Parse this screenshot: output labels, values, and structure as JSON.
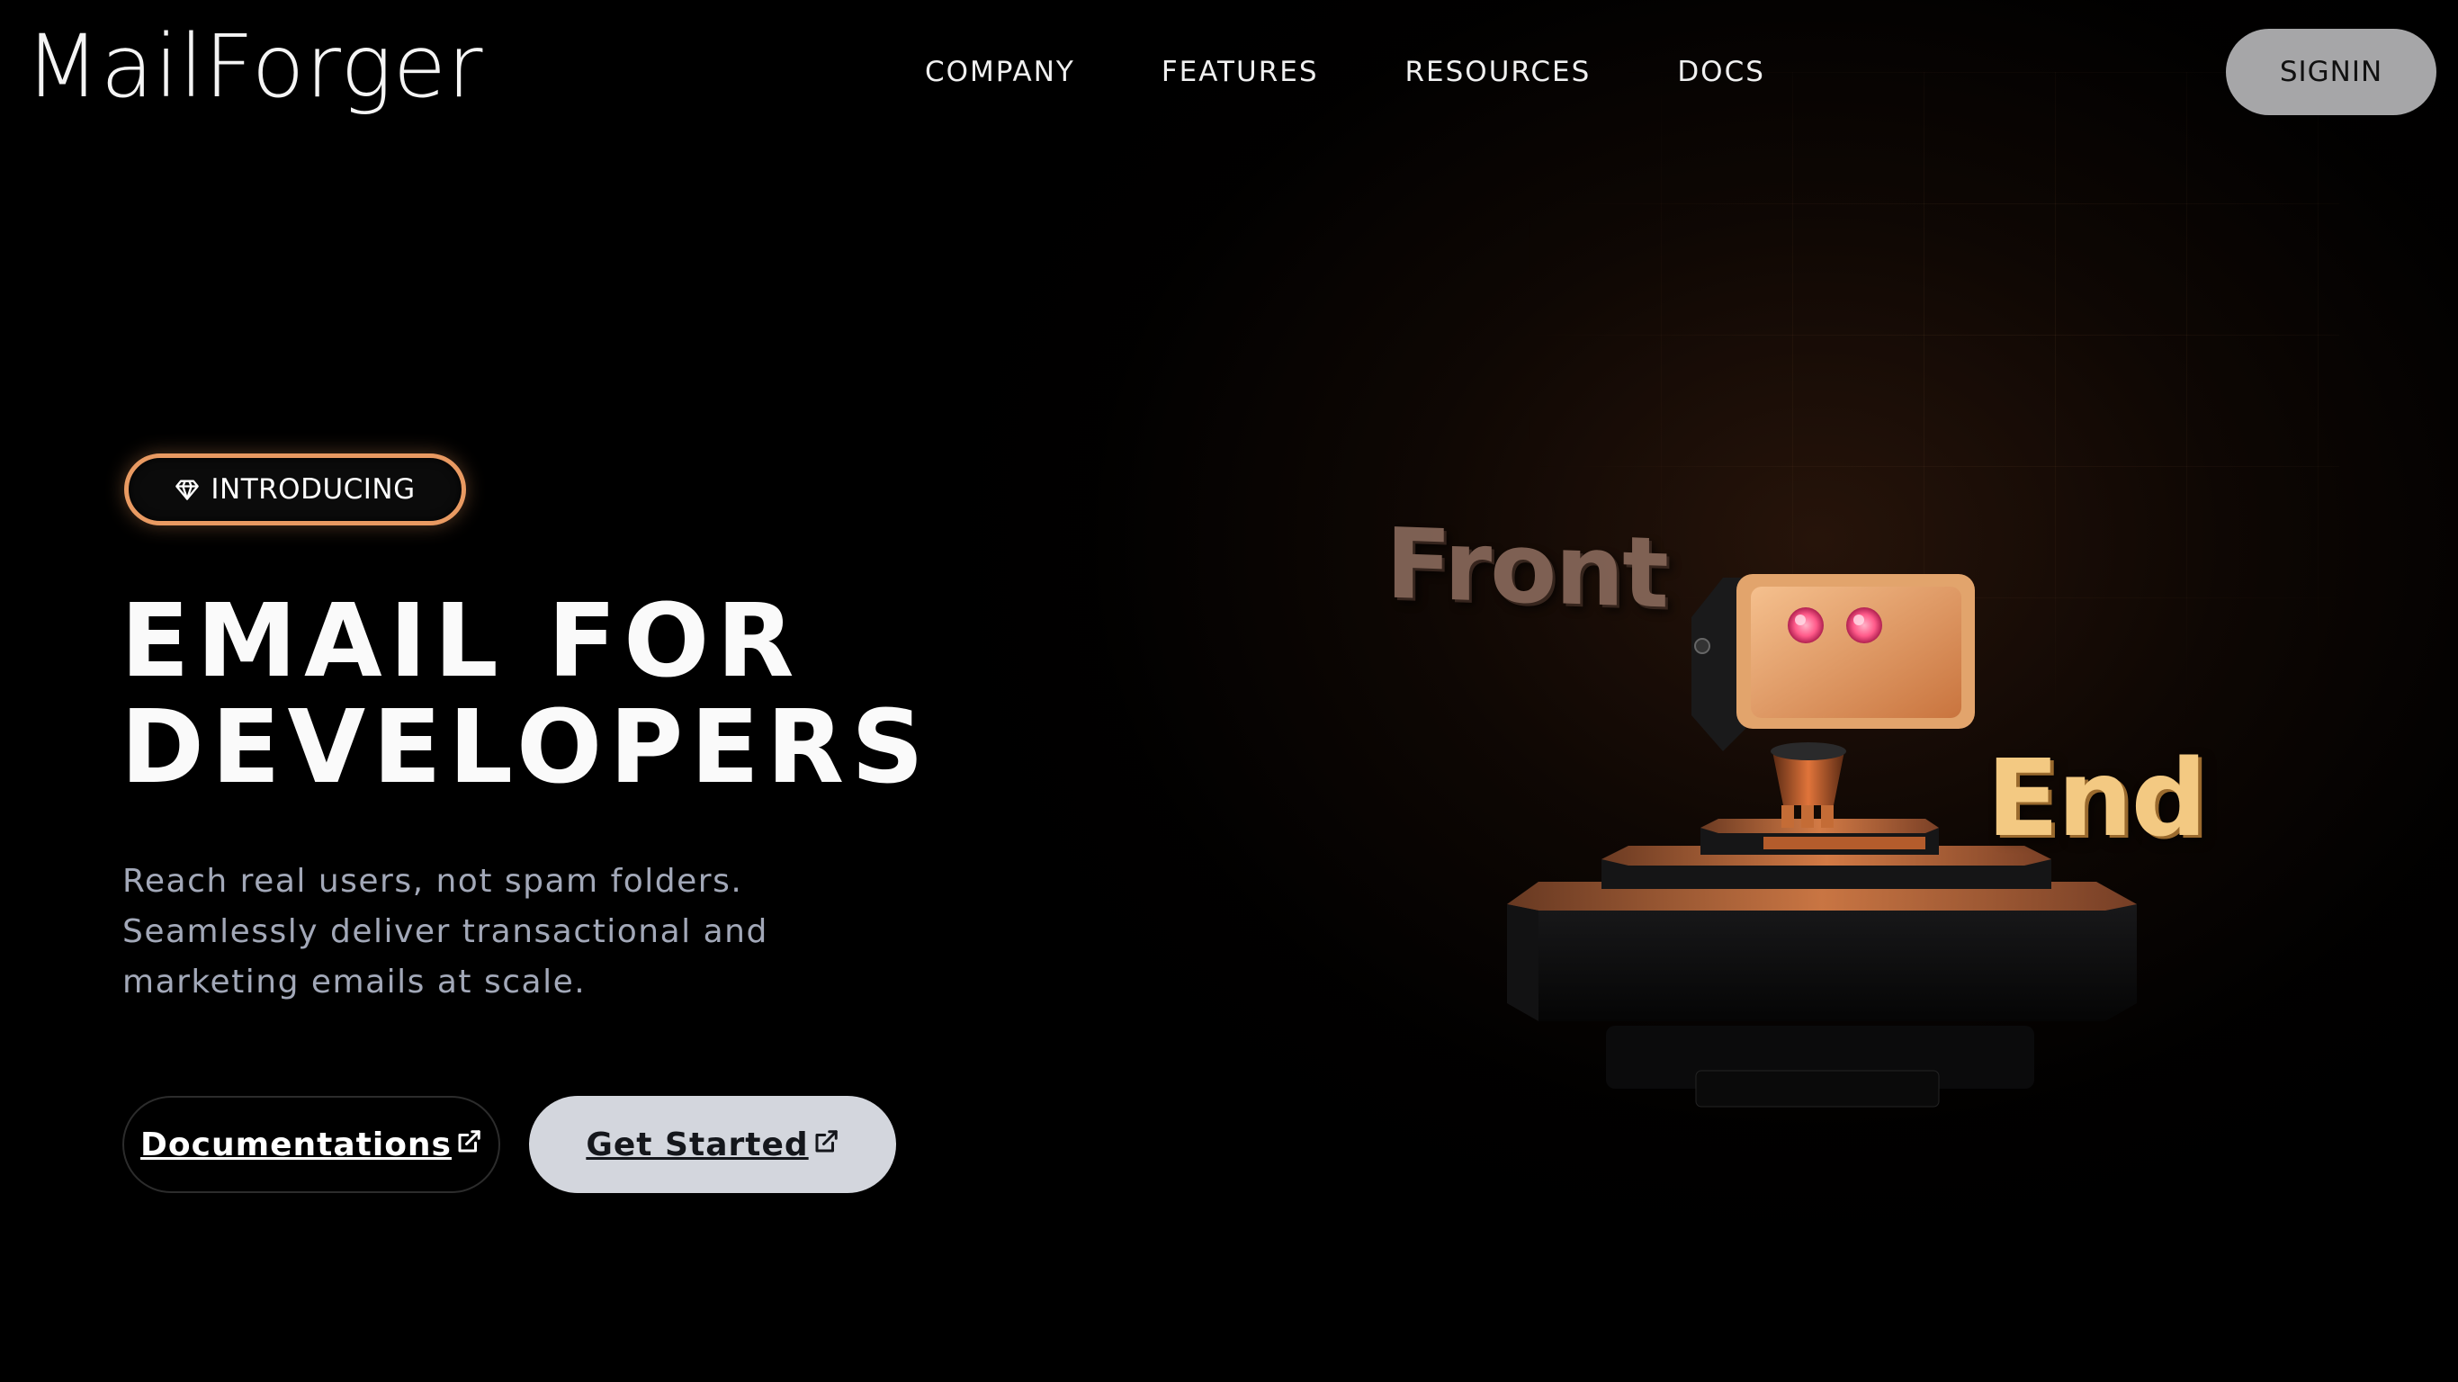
{
  "header": {
    "logo": "MailForger",
    "nav": [
      "COMPANY",
      "FEATURES",
      "RESOURCES",
      "DOCS"
    ],
    "signin_label": "SIGNIN"
  },
  "hero": {
    "badge_label": "INTRODUCING",
    "headline_line1": "EMAIL FOR",
    "headline_line2": "DEVELOPERS",
    "subtext_line1": "Reach real users, not spam folders.",
    "subtext_line2": "Seamlessly deliver transactional and",
    "subtext_line3": "marketing emails at scale.",
    "docs_button_label": "Documentations",
    "start_button_label": "Get Started"
  },
  "illustration": {
    "word_left": "Front",
    "word_right": "End"
  },
  "colors": {
    "background": "#000000",
    "accent_orange": "#e99a62",
    "signin_bg": "#a6a6a8",
    "start_bg": "#d3d6dd",
    "subtext": "#a2a8b8"
  },
  "icons": [
    "diamond-icon",
    "external-link-icon",
    "robot-illustration"
  ]
}
